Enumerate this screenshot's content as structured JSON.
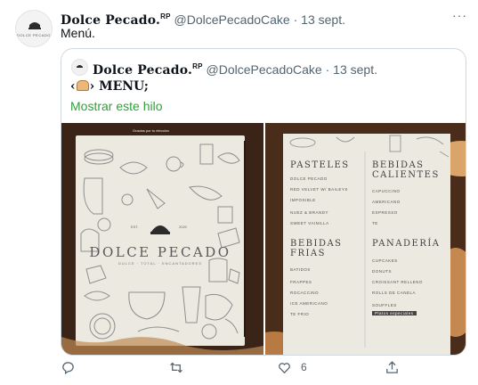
{
  "tweet": {
    "display_name": "Dolce Pecado.",
    "display_suffix": "RP",
    "handle": "@DolcePecadoCake",
    "separator": "·",
    "date": "13 sept.",
    "text": "Menú.",
    "more_label": "···",
    "avatar_text": "DOLCE PECADO"
  },
  "quote": {
    "display_name": "Dolce Pecado.",
    "display_suffix": "RP",
    "handle": "@DolcePecadoCake",
    "separator": "·",
    "date": "13 sept.",
    "text_open": "‹",
    "text_close": "›",
    "text": " MENU;",
    "show_thread": "Mostrar este hilo"
  },
  "media": {
    "left": {
      "tagline": "Gracias por tu elección",
      "brand": "DOLCE PECADO",
      "est_left": "EST.",
      "est_right": "2020",
      "brand_sub": "DULCE · TOTAL · ENCANTADORES"
    },
    "right": {
      "sections": [
        {
          "title_lines": [
            "PASTELES"
          ],
          "items": [
            "DOLCE PECADO",
            "RED VELVET W/ BAILEYS",
            "IMPOSIBLE",
            "NUEZ & BRANDY",
            "SWEET VAINILLA"
          ]
        },
        {
          "title_lines": [
            "BEBIDAS",
            "FRIAS"
          ],
          "items": [
            "BATIDOS",
            "FRAPPES",
            "ROCACCINO",
            "ICE AMERICANO",
            "TE FRIO"
          ]
        },
        {
          "title_lines": [
            "BEBIDAS",
            "CALIENTES"
          ],
          "items": [
            "CAPUCCINO",
            "AMERICANO",
            "ESPRESSO",
            "TE"
          ]
        },
        {
          "title_lines": [
            "PANADERÍA"
          ],
          "items": [
            "CUPCAKES",
            "DONUTS",
            "CROISSANT RELLENO",
            "ROLLS DE CANELA",
            "SOUFFLES"
          ]
        }
      ],
      "footer_tag": "Platos especiales"
    }
  },
  "actions": {
    "reply_count": "",
    "retweet_count": "",
    "like_count": "6",
    "share_count": ""
  },
  "colors": {
    "link_green": "#2ea23a",
    "secondary_text": "#536471",
    "border": "#cfd9de"
  },
  "icons": [
    "reply-icon",
    "retweet-icon",
    "like-icon",
    "share-icon",
    "more-icon",
    "bread-icon"
  ]
}
